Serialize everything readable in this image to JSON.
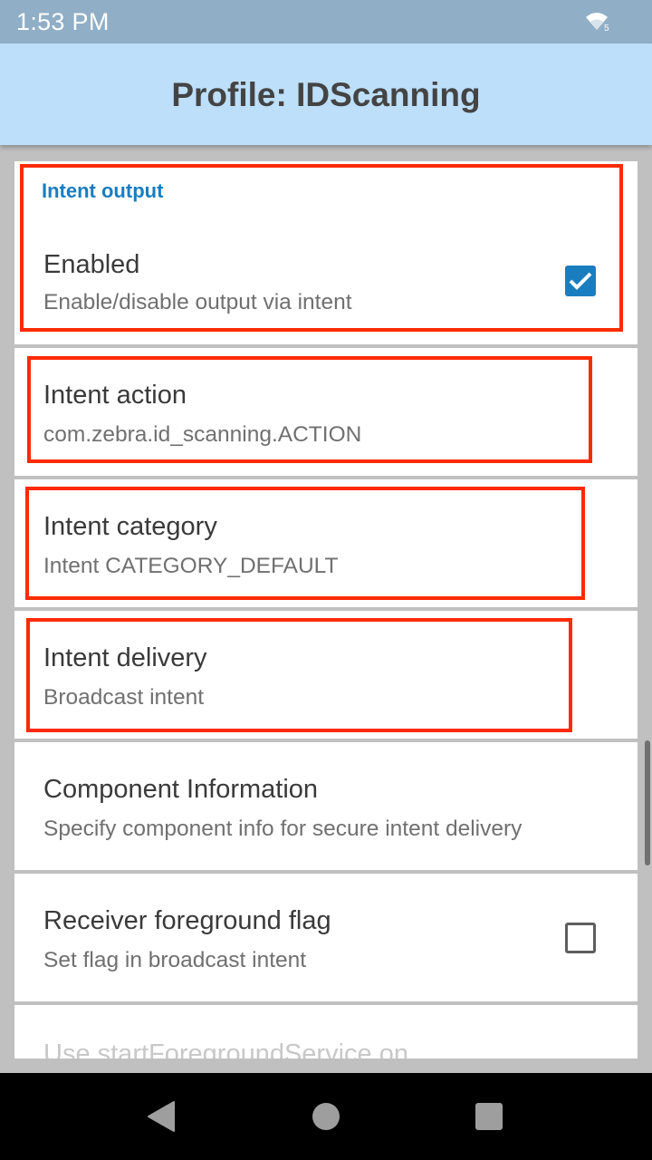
{
  "status_bar": {
    "time": "1:53 PM",
    "icons": [
      "wifi-icon"
    ]
  },
  "app_bar": {
    "title": "Profile: IDScanning"
  },
  "section": {
    "category_title": "Intent output"
  },
  "preferences": [
    {
      "title": "Enabled",
      "summary": "Enable/disable output via intent",
      "widget": "checkbox",
      "checked": true
    },
    {
      "title": "Intent action",
      "summary": "com.zebra.id_scanning.ACTION"
    },
    {
      "title": "Intent category",
      "summary": "Intent CATEGORY_DEFAULT"
    },
    {
      "title": "Intent delivery",
      "summary": "Broadcast intent"
    },
    {
      "title": "Component Information",
      "summary": "Specify component info for secure intent delivery"
    },
    {
      "title": "Receiver foreground flag",
      "summary": "Set flag in broadcast intent",
      "widget": "checkbox",
      "checked": false
    },
    {
      "title": "Use startForegroundService on",
      "summary": ""
    }
  ],
  "nav_bar": {
    "icons": [
      "back-icon",
      "home-icon",
      "recents-icon"
    ]
  },
  "colors": {
    "status_bar": "#90aec6",
    "app_bar": "#bddffa",
    "accent": "#1a7dbf",
    "highlight": "#ff2a00",
    "background": "#c0c0c0"
  }
}
